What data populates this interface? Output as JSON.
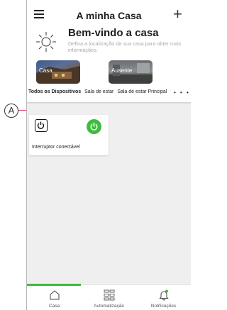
{
  "header": {
    "title": "A minha Casa",
    "welcome": "Bem-vindo a casa",
    "description": "Defina a localização da sua casa para obter mais informações.",
    "menu_icon": "hamburger-menu-icon",
    "add_icon": "plus-icon",
    "weather_icon": "sun-icon"
  },
  "scenes": [
    {
      "label": "Casa"
    },
    {
      "label": "Ausente"
    }
  ],
  "tabs": [
    {
      "label": "Todos os Dispositivos",
      "active": true
    },
    {
      "label": "Sala de estar"
    },
    {
      "label": "Sala de estar Principal"
    }
  ],
  "tabs_more": "• • •",
  "devices": [
    {
      "label": "Interruptor conectável",
      "state": "on",
      "icon": "plug-icon"
    }
  ],
  "bottom_nav": [
    {
      "label": "Casa",
      "icon": "home-icon",
      "active": true
    },
    {
      "label": "Automatização",
      "icon": "grid-icon"
    },
    {
      "label": "Notificações",
      "icon": "bell-icon"
    }
  ],
  "annotation": {
    "letter": "A"
  },
  "colors": {
    "accent": "#3dbd3d",
    "callout_line": "#e8457a"
  }
}
